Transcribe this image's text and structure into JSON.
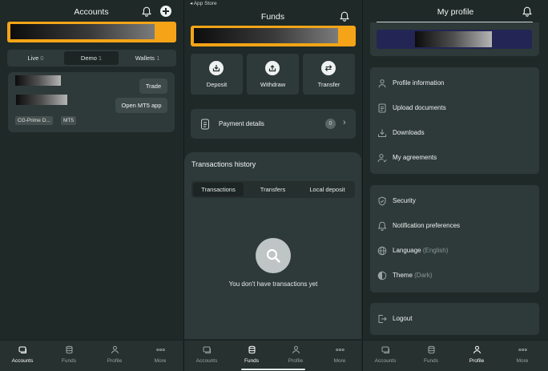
{
  "colors": {
    "accent_orange": "#f5a417",
    "background": "#1f2928",
    "card": "#2e3a39",
    "navy_banner": "#232655"
  },
  "accounts": {
    "title": "Accounts",
    "tabs": [
      {
        "label": "Live",
        "count": "0"
      },
      {
        "label": "Demo",
        "count": "1"
      },
      {
        "label": "Wallets",
        "count": "1"
      }
    ],
    "trade_label": "Trade",
    "open_mt5_label": "Open MT5 app",
    "chips": [
      "CG-Prime D...",
      "MT5"
    ]
  },
  "funds": {
    "status_bar": "◂ App Store",
    "title": "Funds",
    "actions": [
      {
        "label": "Deposit",
        "icon": "deposit-icon"
      },
      {
        "label": "Withdraw",
        "icon": "withdraw-icon"
      },
      {
        "label": "Transfer",
        "icon": "transfer-icon"
      }
    ],
    "payment_details": {
      "label": "Payment details",
      "count": "0"
    },
    "history": {
      "title": "Transactions history",
      "tabs": [
        "Transactions",
        "Transfers",
        "Local deposit"
      ],
      "empty_text": "You don't have transactions yet"
    }
  },
  "profile": {
    "title": "My profile",
    "menu_group_1": [
      {
        "label": "Profile information",
        "icon": "user-icon"
      },
      {
        "label": "Upload documents",
        "icon": "document-icon"
      },
      {
        "label": "Downloads",
        "icon": "download-icon"
      },
      {
        "label": "My agreements",
        "icon": "agreement-icon"
      }
    ],
    "menu_group_2": [
      {
        "label": "Security",
        "icon": "shield-icon"
      },
      {
        "label": "Notification preferences",
        "icon": "bell-icon"
      },
      {
        "label": "Language",
        "value": "(English)",
        "icon": "globe-icon"
      },
      {
        "label": "Theme",
        "value": "(Dark)",
        "icon": "theme-icon"
      }
    ],
    "logout_label": "Logout"
  },
  "nav": {
    "items": [
      {
        "label": "Accounts",
        "icon": "accounts-icon"
      },
      {
        "label": "Funds",
        "icon": "funds-icon"
      },
      {
        "label": "Profile",
        "icon": "profile-icon"
      },
      {
        "label": "More",
        "icon": "more-icon"
      }
    ]
  }
}
